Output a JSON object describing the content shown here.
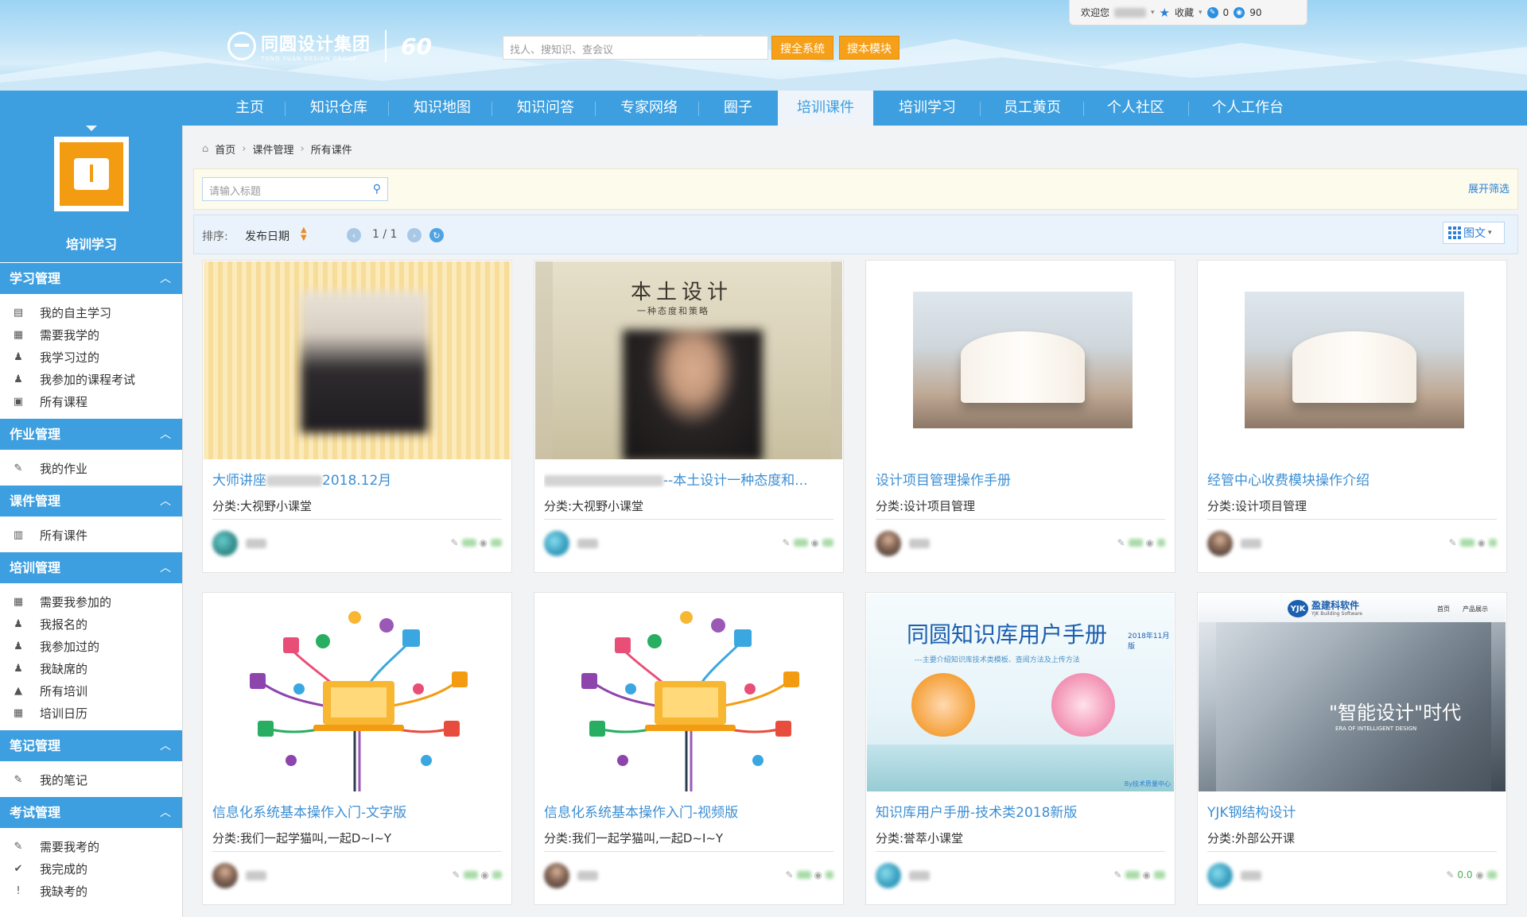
{
  "header": {
    "logo_cn": "同圆设计集团",
    "logo_en": "TONG YUAN DESIGN GROUP",
    "logo_badge": "60",
    "search_placeholder": "找人、搜知识、查会议",
    "search_all_label": "搜全系统",
    "search_module_label": "搜本模块",
    "welcome": "欢迎您",
    "favorites": "收藏",
    "msg_count": "0",
    "view_count": "90"
  },
  "nav": [
    {
      "label": "主页"
    },
    {
      "label": "知识仓库"
    },
    {
      "label": "知识地图"
    },
    {
      "label": "知识问答"
    },
    {
      "label": "专家网络"
    },
    {
      "label": "圈子"
    },
    {
      "label": "培训课件",
      "active": true
    },
    {
      "label": "培训学习"
    },
    {
      "label": "员工黄页"
    },
    {
      "label": "个人社区"
    },
    {
      "label": "个人工作台"
    }
  ],
  "sidebar": {
    "title": "培训学习",
    "sections": [
      {
        "title": "学习管理",
        "items": [
          "我的自主学习",
          "需要我学的",
          "我学习过的",
          "我参加的课程考试",
          "所有课程"
        ]
      },
      {
        "title": "作业管理",
        "items": [
          "我的作业"
        ]
      },
      {
        "title": "课件管理",
        "items": [
          "所有课件"
        ]
      },
      {
        "title": "培训管理",
        "items": [
          "需要我参加的",
          "我报名的",
          "我参加过的",
          "我缺席的",
          "所有培训",
          "培训日历"
        ]
      },
      {
        "title": "笔记管理",
        "items": [
          "我的笔记"
        ]
      },
      {
        "title": "考试管理",
        "items": [
          "需要我考的",
          "我完成的",
          "我缺考的"
        ]
      }
    ]
  },
  "breadcrumb": [
    "首页",
    "课件管理",
    "所有课件"
  ],
  "filter": {
    "placeholder": "请输入标题",
    "expand_label": "展开筛选"
  },
  "sortbar": {
    "sort_label": "排序:",
    "sort_field": "发布日期",
    "page_text": "1 / 1",
    "view_label": "图文"
  },
  "cards": [
    {
      "title_a": "大师讲座",
      "title_b": "2018.12月",
      "category": "分类:大视野小课堂",
      "thumb": "stripe-photo",
      "stat": ""
    },
    {
      "title_a": "",
      "title_b": "--本土设计一种态度和...",
      "category": "分类:大视野小课堂",
      "thumb": "scroll-photo",
      "stat": ""
    },
    {
      "title_a": "设计项目管理操作手册",
      "title_b": "",
      "category": "分类:设计项目管理",
      "thumb": "book",
      "stat": ""
    },
    {
      "title_a": "经管中心收费模块操作介绍",
      "title_b": "",
      "category": "分类:设计项目管理",
      "thumb": "book",
      "stat": ""
    },
    {
      "title_a": "信息化系统基本操作入门-文字版",
      "title_b": "",
      "category": "分类:我们一起学猫叫,一起D~I~Y",
      "thumb": "network",
      "stat": ""
    },
    {
      "title_a": "信息化系统基本操作入门-视频版",
      "title_b": "",
      "category": "分类:我们一起学猫叫,一起D~I~Y",
      "thumb": "network",
      "stat": ""
    },
    {
      "title_a": "知识库用户手册-技术类2018新版",
      "title_b": "",
      "category": "分类:誉萃小课堂",
      "thumb": "manual",
      "stat": ""
    },
    {
      "title_a": "YJK钢结构设计",
      "title_b": "",
      "category": "分类:外部公开课",
      "thumb": "yjk",
      "stat": "0.0"
    }
  ],
  "thumb_text": {
    "scroll_title": "本土设计",
    "scroll_sub": "一种态度和策略",
    "manual_title": "同圆知识库用户手册",
    "manual_date": "2018年11月版",
    "manual_sub": "---主要介绍知识库技术类模板、查阅方法及上传方法",
    "manual_by": "By技术质量中心",
    "yjk_logo": "YJK",
    "yjk_brand": "盈建科软件",
    "yjk_brand_en": "YJK Building Software",
    "yjk_nav1": "首页",
    "yjk_nav2": "产品展示",
    "yjk_headline": "\"智能设计\"时代",
    "yjk_sub": "ERA OF INTELLIGENT DESIGN"
  },
  "colors": {
    "nav_blue": "#3d9fe0",
    "link_blue": "#3d8fd3",
    "orange": "#f6a01a"
  }
}
